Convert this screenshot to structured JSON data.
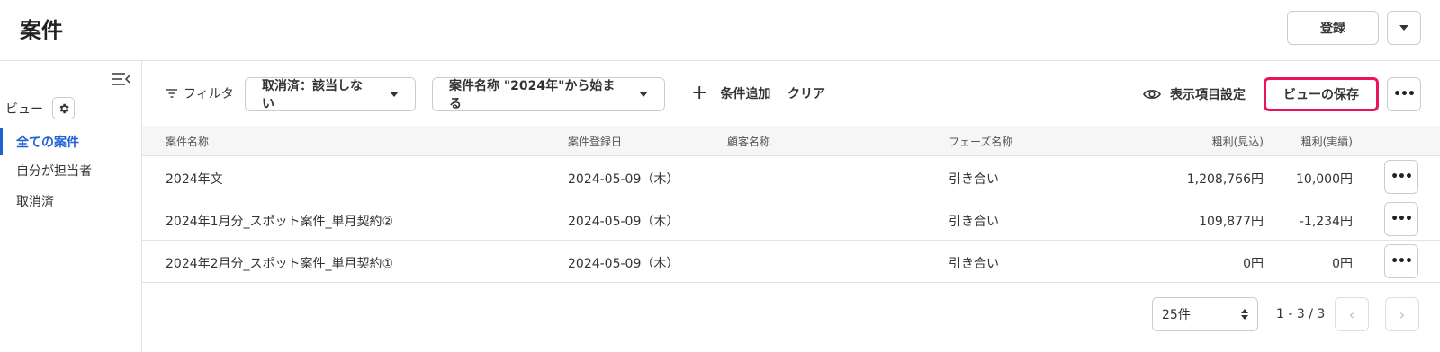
{
  "header": {
    "title": "案件",
    "register_label": "登録"
  },
  "sidebar": {
    "view_label": "ビュー",
    "items": [
      {
        "label": "全ての案件",
        "active": true
      },
      {
        "label": "自分が担当者",
        "active": false
      },
      {
        "label": "取消済",
        "active": false
      }
    ]
  },
  "filterbar": {
    "filter_label": "フィルタ",
    "filters": [
      {
        "label": "取消済：該当しない"
      },
      {
        "label": "案件名称 \"2024年\"から始まる"
      }
    ],
    "add_condition_label": "条件追加",
    "clear_label": "クリア",
    "display_settings_label": "表示項目設定",
    "save_view_label": "ビューの保存",
    "highlight_color": "#e8155a"
  },
  "table": {
    "columns": [
      "案件名称",
      "案件登録日",
      "顧客名称",
      "フェーズ名称",
      "粗利(見込)",
      "粗利(実績)"
    ],
    "rows": [
      {
        "name": "2024年文",
        "date": "2024-05-09（木）",
        "customer": "",
        "phase": "引き合い",
        "gross_expected": "1,208,766円",
        "gross_actual": "10,000円"
      },
      {
        "name": "2024年1月分_スポット案件_単月契約②",
        "date": "2024-05-09（木）",
        "customer": "",
        "phase": "引き合い",
        "gross_expected": "109,877円",
        "gross_actual": "-1,234円"
      },
      {
        "name": "2024年2月分_スポット案件_単月契約①",
        "date": "2024-05-09（木）",
        "customer": "",
        "phase": "引き合い",
        "gross_expected": "0円",
        "gross_actual": "0円"
      }
    ]
  },
  "pagination": {
    "per_page": "25件",
    "range": "1 - 3 / 3"
  },
  "colors": {
    "accent": "#1f62d6"
  }
}
